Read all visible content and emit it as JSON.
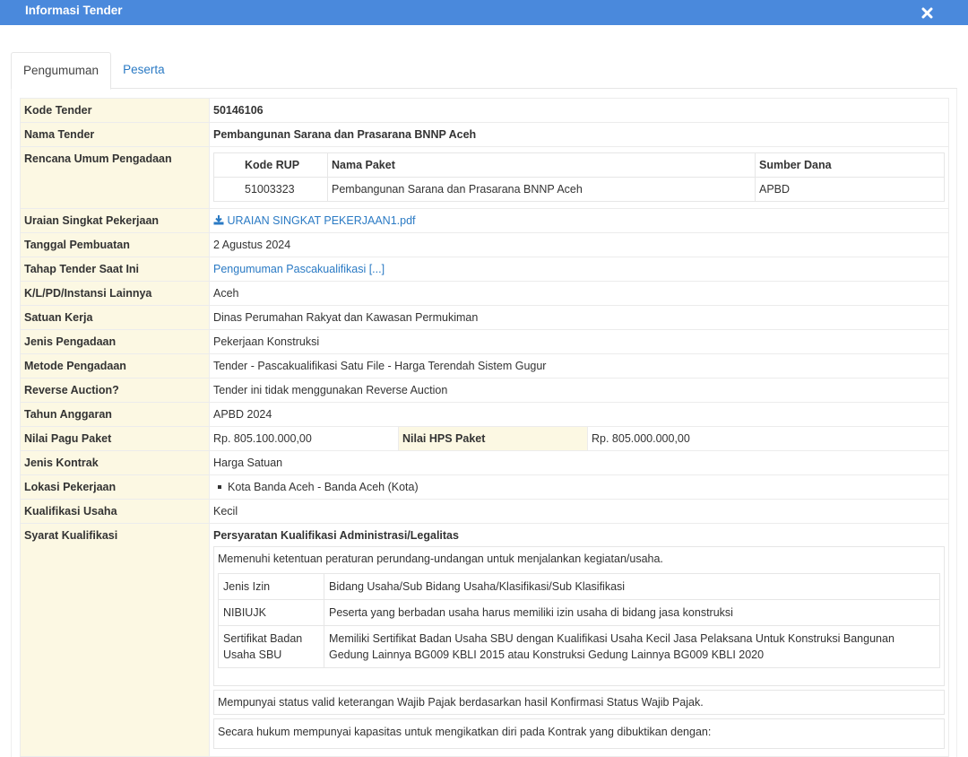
{
  "header": {
    "title": "Informasi Tender",
    "close_icon": "close-icon"
  },
  "tabs": [
    {
      "label": "Pengumuman"
    },
    {
      "label": "Peserta"
    }
  ],
  "rows": {
    "kode_tender": {
      "label": "Kode Tender",
      "value": "50146106"
    },
    "nama_tender": {
      "label": "Nama Tender",
      "value": "Pembangunan Sarana dan Prasarana BNNP Aceh"
    },
    "rup": {
      "label": "Rencana Umum Pengadaan",
      "headers": {
        "kode": "Kode RUP",
        "nama": "Nama Paket",
        "sumber": "Sumber Dana"
      },
      "row": {
        "kode": "51003323",
        "nama": "Pembangunan Sarana dan Prasarana BNNP Aceh",
        "sumber": "APBD"
      }
    },
    "uraian": {
      "label": "Uraian Singkat Pekerjaan",
      "value": "URAIAN SINGKAT PEKERJAAN1.pdf",
      "icon": "download-icon"
    },
    "tanggal": {
      "label": "Tanggal Pembuatan",
      "value": "2 Agustus 2024"
    },
    "tahap": {
      "label": "Tahap Tender Saat Ini",
      "value": "Pengumuman Pascakualifikasi [...]"
    },
    "klpd": {
      "label": "K/L/PD/Instansi Lainnya",
      "value": "Aceh"
    },
    "satker": {
      "label": "Satuan Kerja",
      "value": "Dinas Perumahan Rakyat dan Kawasan Permukiman"
    },
    "jenis_pengadaan": {
      "label": "Jenis Pengadaan",
      "value": "Pekerjaan Konstruksi"
    },
    "metode": {
      "label": "Metode Pengadaan",
      "value": "Tender - Pascakualifikasi Satu File - Harga Terendah Sistem Gugur"
    },
    "reverse": {
      "label": "Reverse Auction?",
      "value": "Tender ini tidak menggunakan Reverse Auction"
    },
    "tahun": {
      "label": "Tahun Anggaran",
      "value": "APBD 2024"
    },
    "pagu": {
      "label": "Nilai Pagu Paket",
      "value": "Rp. 805.100.000,00",
      "hps_label": "Nilai HPS Paket",
      "hps_value": "Rp. 805.000.000,00"
    },
    "kontrak": {
      "label": "Jenis Kontrak",
      "value": "Harga Satuan"
    },
    "lokasi": {
      "label": "Lokasi Pekerjaan",
      "value": "Kota Banda Aceh - Banda Aceh (Kota)"
    },
    "kualifikasi": {
      "label": "Kualifikasi Usaha",
      "value": "Kecil"
    },
    "syarat": {
      "label": "Syarat Kualifikasi",
      "heading": "Persyaratan Kualifikasi Administrasi/Legalitas",
      "item1": "Memenuhi ketentuan peraturan perundang-undangan untuk menjalankan kegiatan/usaha.",
      "izin": [
        {
          "a": "Jenis Izin",
          "b": "Bidang Usaha/Sub Bidang Usaha/Klasifikasi/Sub Klasifikasi"
        },
        {
          "a": "NIBIUJK",
          "b": "Peserta yang berbadan usaha harus memiliki izin usaha di bidang jasa konstruksi"
        },
        {
          "a": "Sertifikat Badan Usaha SBU",
          "b": "Memiliki Sertifikat Badan Usaha SBU dengan Kualifikasi Usaha Kecil Jasa Pelaksana Untuk Konstruksi Bangunan Gedung Lainnya BG009 KBLI 2015 atau Konstruksi Gedung Lainnya BG009 KBLI 2020"
        }
      ],
      "item2": "Mempunyai status valid keterangan Wajib Pajak berdasarkan hasil Konfirmasi Status Wajib Pajak.",
      "item3": "Secara hukum mempunyai kapasitas untuk mengikatkan diri pada Kontrak yang dibuktikan dengan:"
    }
  }
}
